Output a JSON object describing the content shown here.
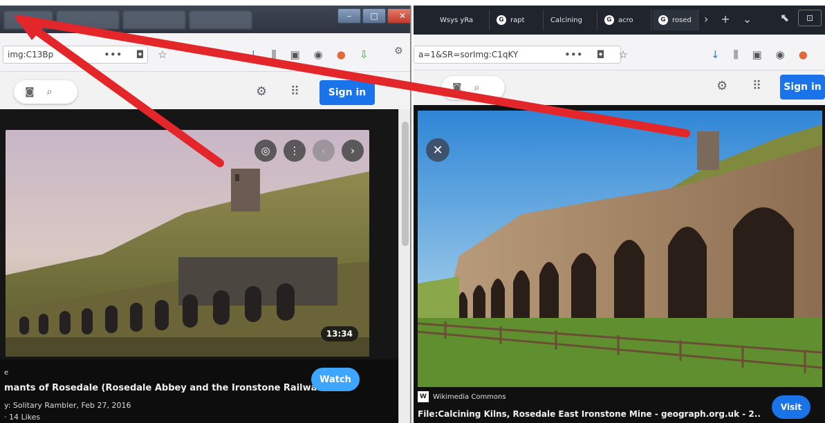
{
  "left_window": {
    "address_text": "img:C13Bp",
    "google": {
      "sign_in_label": "Sign in"
    },
    "viewer": {
      "video_duration": "13:34",
      "info_line1": "e",
      "title": "mants of Rosedale (Rosedale Abbey and the Ironstone Railwa...",
      "meta": "y: Solitary Rambler, Feb 27, 2016",
      "likes": "· 14 Likes",
      "description": "... ... ... ... ...",
      "watch_label": "Watch"
    }
  },
  "right_window": {
    "tabs": [
      {
        "label": "Wsys yRa",
        "icon": ""
      },
      {
        "label": "rapt",
        "icon": "G"
      },
      {
        "label": "Calcining",
        "icon": ""
      },
      {
        "label": "acro",
        "icon": "G"
      },
      {
        "label": "rosed",
        "icon": "G"
      }
    ],
    "address_text": "a=1&SR=sorImg:C1qKY",
    "google": {
      "sign_in_label": "Sign in"
    },
    "viewer": {
      "source_name": "Wikimedia Commons",
      "file_title": "File:Calcining Kilns, Rosedale East Ironstone Mine - geograph.org.uk - 2..",
      "visit_label": "Visit"
    }
  },
  "colors": {
    "annotation_red": "#e3262a",
    "google_blue": "#1a73e8",
    "youtube_watch_blue": "#3ea6ff"
  }
}
